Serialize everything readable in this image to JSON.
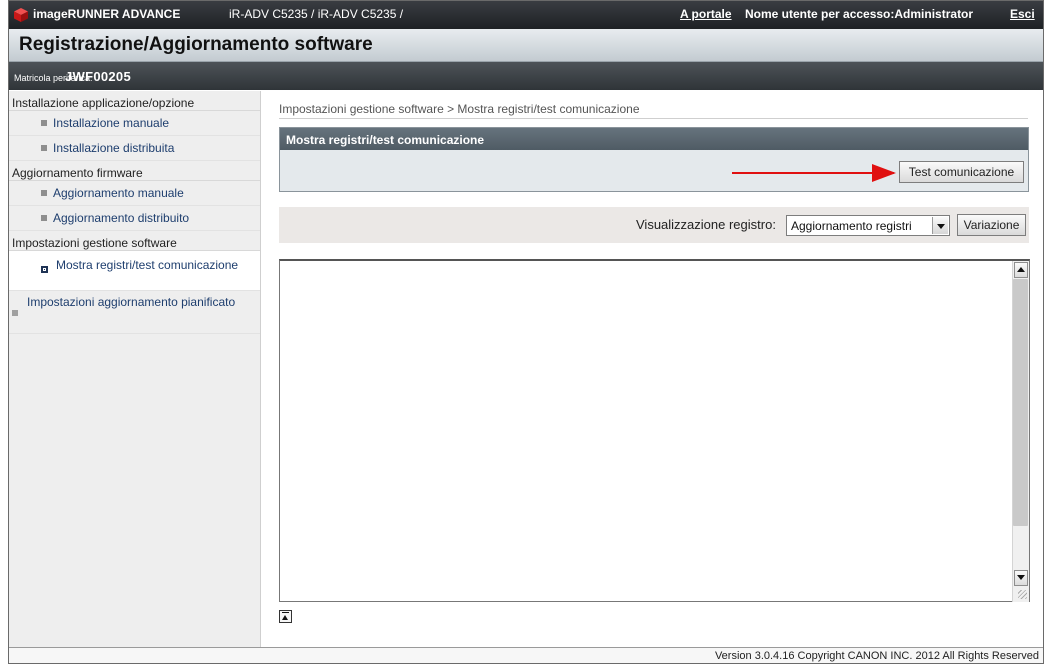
{
  "header": {
    "app_name": "imageRUNNER ADVANCE",
    "device": "iR-ADV C5235 / iR-ADV C5235 /",
    "portal_link": "A portale",
    "user_label": "Nome utente per accesso:Administrator",
    "exit_link": "Esci",
    "logo_icon": "canon-cube-icon",
    "logo_color": "#d81c1c"
  },
  "page_title": "Registrazione/Aggiornamento software",
  "serial": {
    "label": "Matricola periferica:",
    "value": "JWF00205"
  },
  "sidebar": {
    "sections": [
      {
        "label": "Installazione applicazione/opzione",
        "items": [
          {
            "label": "Installazione manuale"
          },
          {
            "label": "Installazione distribuita"
          }
        ]
      },
      {
        "label": "Aggiornamento firmware",
        "items": [
          {
            "label": "Aggiornamento manuale"
          },
          {
            "label": "Aggiornamento distribuito"
          }
        ]
      },
      {
        "label": "Impostazioni gestione software",
        "items": [
          {
            "label": "Mostra registri/test comunicazione",
            "selected": true
          }
        ]
      }
    ],
    "toplevel_item": "Impostazioni aggiornamento pianificato"
  },
  "main": {
    "breadcrumb": "Impostazioni gestione software > Mostra registri/test comunicazione",
    "panel_title": "Mostra registri/test comunicazione",
    "test_button": "Test comunicazione",
    "log_label": "Visualizzazione registro:",
    "log_select_value": "Aggiornamento registri",
    "change_button": "Variazione",
    "log_text": ""
  },
  "annotation": {
    "arrow_color": "#e01010"
  },
  "footer": {
    "version": "Version 3.0.4.16 Copyright CANON INC. 2012 All Rights Reserved"
  }
}
